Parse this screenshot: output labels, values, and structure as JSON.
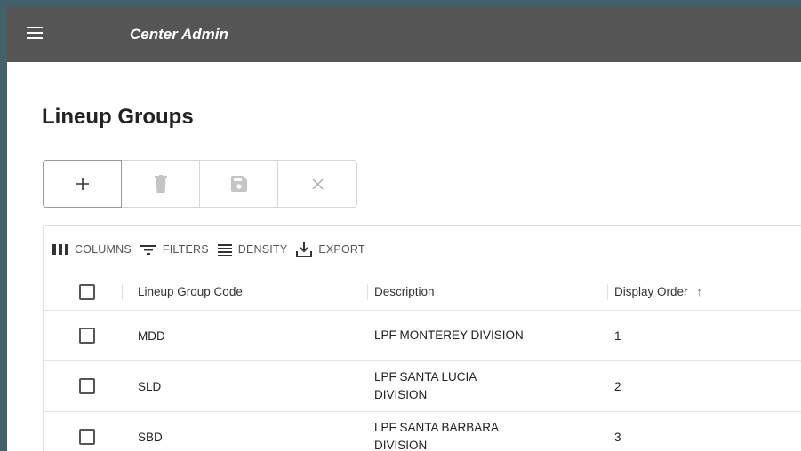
{
  "appbar": {
    "title": "Center Admin",
    "menu_icon": "menu-icon"
  },
  "page": {
    "title": "Lineup Groups"
  },
  "actions": [
    {
      "name": "add",
      "icon": "plus-icon",
      "enabled": true
    },
    {
      "name": "delete",
      "icon": "trash-icon",
      "enabled": false
    },
    {
      "name": "save",
      "icon": "save-icon",
      "enabled": false
    },
    {
      "name": "cancel",
      "icon": "close-icon",
      "enabled": false
    }
  ],
  "toolbar": {
    "columns_label": "COLUMNS",
    "filters_label": "FILTERS",
    "density_label": "DENSITY",
    "export_label": "EXPORT"
  },
  "table": {
    "headers": [
      "Lineup Group Code",
      "Description",
      "Display Order"
    ],
    "sort_column": "Display Order",
    "sort_direction": "ascending",
    "rows": [
      {
        "code": "MDD",
        "description": "LPF MONTEREY DIVISION",
        "display_order": "1"
      },
      {
        "code": "SLD",
        "description": "LPF SANTA LUCIA DIVISION",
        "display_order": "2"
      },
      {
        "code": "SBD",
        "description": "LPF SANTA BARBARA DIVISION",
        "display_order": "3"
      }
    ]
  },
  "colors": {
    "appbar": "#555555",
    "border_background": "#41606b",
    "icon_enabled": "#333333",
    "icon_disabled": "#c4c4c4"
  }
}
